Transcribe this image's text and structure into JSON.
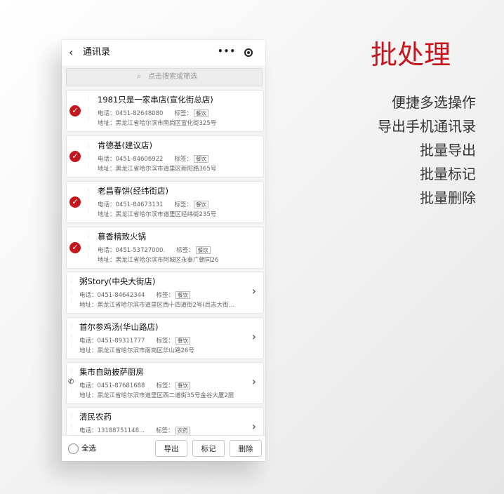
{
  "header": {
    "back_glyph": "‹",
    "title": "通讯录",
    "more_glyph": "•••"
  },
  "search": {
    "icon_glyph": "⌕",
    "placeholder": "点击搜索或筛选"
  },
  "contacts": [
    {
      "name": "1981只是一家串店(宣化街总店)",
      "phone": "电话：0451-82648080",
      "tag_label": "标签：",
      "tag": "餐饮",
      "address": "地址：黑龙江省哈尔滨市南岗区宣化街325号",
      "selected": true
    },
    {
      "name": "肯德基(建议店)",
      "phone": "电话：0451-84606922",
      "tag_label": "标签：",
      "tag": "餐饮",
      "address": "地址：黑龙江省哈尔滨市道里区新阳路365号",
      "selected": true
    },
    {
      "name": "老昌春饼(经纬街店)",
      "phone": "电话：0451-84673131",
      "tag_label": "标签：",
      "tag": "餐饮",
      "address": "地址：黑龙江省哈尔滨市道里区经纬街235号",
      "selected": true
    },
    {
      "name": "慕香精致火锅",
      "phone": "电话：0451-53727000.",
      "tag_label": "标签：",
      "tag": "餐饮",
      "address": "地址：黑龙江省哈尔滨市阿城区永泰广朝同26",
      "selected": true
    },
    {
      "name": "粥Story(中央大街店)",
      "phone": "电话：0451-84642344",
      "tag_label": "标签：",
      "tag": "餐饮",
      "address": "地址：黑龙江省哈尔滨市道里区西十四道街2号(尚志大街…",
      "selected": false
    },
    {
      "name": "首尔参鸡汤(华山路店)",
      "phone": "电话：0451-89311777",
      "tag_label": "标签：",
      "tag": "餐饮",
      "address": "地址：黑龙江省哈尔滨市南岗区华山路26号",
      "selected": false
    },
    {
      "name": "集市自助披萨厨房",
      "phone": "电话：0451-87681688",
      "tag_label": "标签：",
      "tag": "餐饮",
      "address": "地址：黑龙江省哈尔滨市道里区西二道街35号金谷大厦2层",
      "selected": false
    },
    {
      "name": "清民农药",
      "phone": "电话：13188751148...",
      "tag_label": "标签：",
      "tag": "农药",
      "address": "",
      "selected": false
    }
  ],
  "icons": {
    "check_glyph": "✓",
    "chevron_glyph": "›",
    "phone_glyph": "✆"
  },
  "bottom": {
    "select_all": "全选",
    "export": "导出",
    "mark": "标记",
    "delete": "删除"
  },
  "promo": {
    "headline": "批处理",
    "features": [
      "便捷多选操作",
      "导出手机通讯录",
      "批量导出",
      "批量标记",
      "批量删除"
    ]
  },
  "colors": {
    "accent": "#c4161c",
    "card_bg": "#ffffff",
    "page_bg": "#f4f4f4"
  }
}
